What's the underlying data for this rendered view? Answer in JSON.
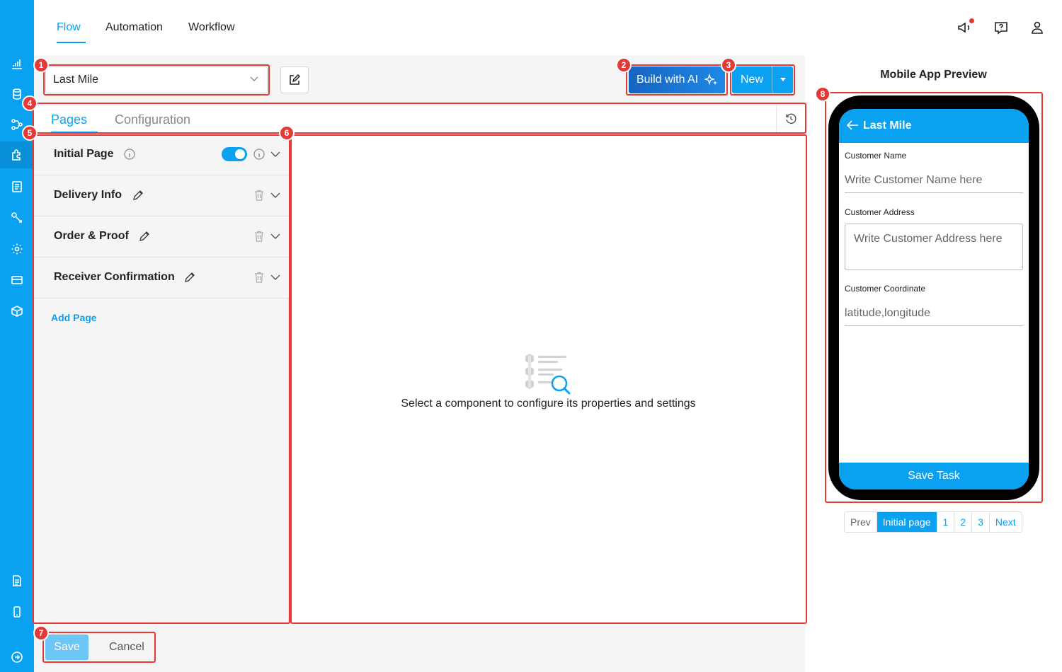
{
  "nav": {
    "tabs": [
      "Flow",
      "Automation",
      "Workflow"
    ],
    "active_tab": "Flow",
    "icons": [
      "megaphone-icon",
      "help-chat-icon",
      "user-icon"
    ]
  },
  "rail": {
    "icons": [
      "analytics-icon",
      "database-icon",
      "flow-icon",
      "plugin-icon",
      "document-list-icon",
      "integration-icon",
      "settings-icon",
      "billing-icon",
      "package-icon",
      "notes-icon",
      "mobile-icon",
      "logout-icon"
    ]
  },
  "toolbar": {
    "flow_name": "Last Mile",
    "build_ai_label": "Build with AI",
    "new_label": "New"
  },
  "tabs": {
    "pages": "Pages",
    "configuration": "Configuration",
    "active": "Pages"
  },
  "pages": {
    "items": [
      {
        "name": "Initial Page",
        "toggle": true
      },
      {
        "name": "Delivery Info"
      },
      {
        "name": "Order & Proof"
      },
      {
        "name": "Receiver Confirmation"
      }
    ],
    "add_label": "Add Page"
  },
  "props": {
    "empty_message": "Select a component to configure its properties and settings"
  },
  "footer": {
    "save_label": "Save",
    "cancel_label": "Cancel"
  },
  "preview": {
    "title": "Mobile App Preview",
    "app_title": "Last Mile",
    "fields": [
      {
        "label": "Customer Name",
        "placeholder": "Write Customer Name here"
      },
      {
        "label": "Customer Address",
        "placeholder": "Write Customer Address here"
      },
      {
        "label": "Customer Coordinate",
        "placeholder": "latitude,longitude"
      }
    ],
    "save_task_label": "Save Task",
    "pager": [
      "Prev",
      "Initial page",
      "1",
      "2",
      "3",
      "Next"
    ],
    "pager_active": "Initial page"
  },
  "annotations": [
    "1",
    "2",
    "3",
    "4",
    "5",
    "6",
    "7",
    "8"
  ],
  "colors": {
    "accent": "#0aa1f0",
    "callout": "#e53935"
  }
}
